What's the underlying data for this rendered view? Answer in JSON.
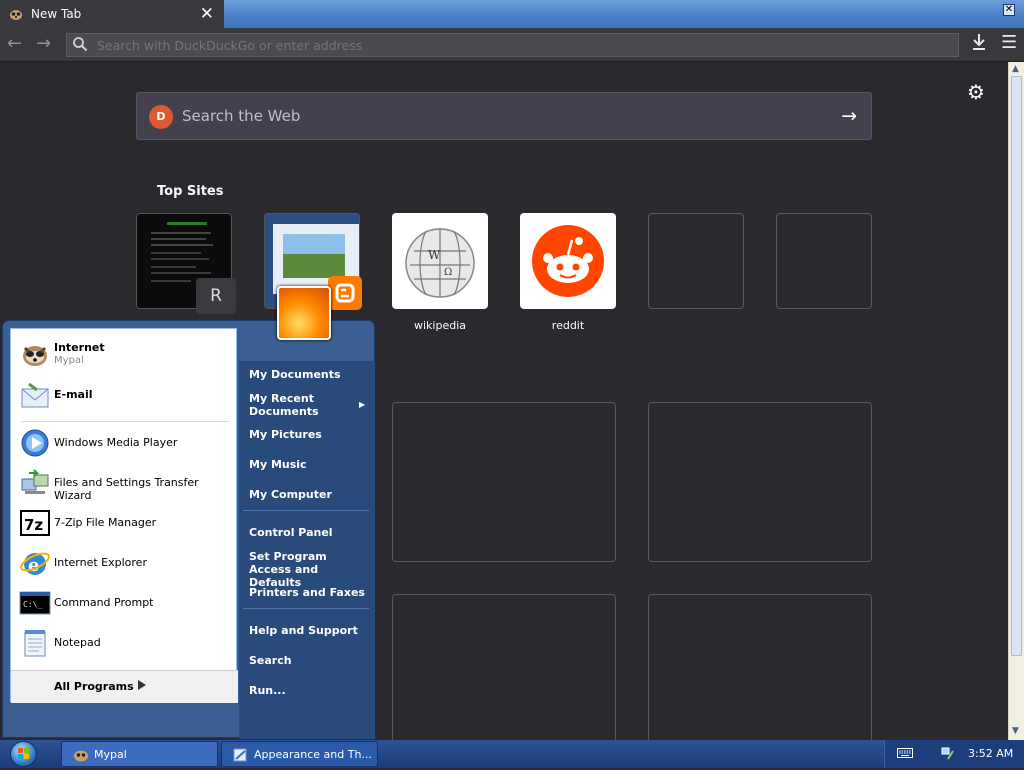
{
  "browser": {
    "tab_title": "New Tab",
    "url_placeholder": "Search with DuckDuckGo or enter address"
  },
  "newtab": {
    "search_placeholder": "Search the Web",
    "top_sites_title": "Top Sites",
    "tiles": [
      {
        "label": "",
        "thumb_letter": "R"
      },
      {
        "label": ""
      },
      {
        "label": "wikipedia"
      },
      {
        "label": "reddit"
      },
      {
        "label": ""
      },
      {
        "label": ""
      }
    ]
  },
  "start_menu": {
    "pinned": [
      {
        "label": "Internet",
        "sub": "Mypal",
        "icon": "mypal-icon"
      },
      {
        "label": "E-mail",
        "icon": "email-icon"
      }
    ],
    "recent": [
      {
        "label": "Windows Media Player",
        "icon": "media-player-icon"
      },
      {
        "label": "Files and Settings Transfer Wizard",
        "icon": "transfer-wizard-icon"
      },
      {
        "label": "7-Zip File Manager",
        "icon": "7zip-icon"
      },
      {
        "label": "Internet Explorer",
        "icon": "internet-explorer-icon"
      },
      {
        "label": "Command Prompt",
        "icon": "command-prompt-icon"
      },
      {
        "label": "Notepad",
        "icon": "notepad-icon"
      }
    ],
    "all_programs": "All Programs",
    "places": {
      "my_documents": "My Documents",
      "my_recent_documents": "My Recent Documents",
      "my_pictures": "My Pictures",
      "my_music": "My Music",
      "my_computer": "My Computer",
      "control_panel": "Control Panel",
      "set_program_access": "Set Program Access and Defaults",
      "printers": "Printers and Faxes",
      "help": "Help and Support",
      "search": "Search",
      "run": "Run..."
    }
  },
  "taskbar": {
    "buttons": [
      {
        "label": "Mypal"
      },
      {
        "label": "Appearance and Th..."
      }
    ],
    "clock": "3:52 AM"
  },
  "colors": {
    "browser_bg": "#2a2a2e",
    "toolbar": "#38383d",
    "xp_blue": "#3b5f92",
    "reddit": "#ff4500",
    "duckduckgo": "#de5833"
  }
}
